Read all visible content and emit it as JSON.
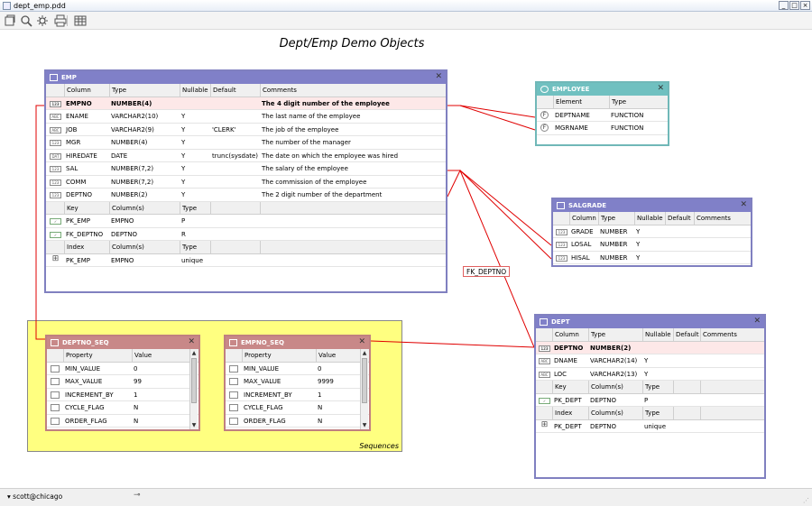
{
  "window": {
    "title": "dept_emp.pdd",
    "buttons": [
      "_",
      "□",
      "×"
    ]
  },
  "toolbar": {
    "icons": [
      "open-icon",
      "zoom-icon",
      "settings-icon",
      "print-icon",
      "grid-icon"
    ]
  },
  "diagram": {
    "title": "Dept/Emp Demo Objects"
  },
  "colors": {
    "table_header": "#8080c8",
    "function_header": "#70c0c0",
    "sequence_header": "#c88888",
    "fk_line": "#e00000",
    "sequence_group": "#ffff80"
  },
  "emp": {
    "title": "EMP",
    "col_headers": [
      "Column",
      "Type",
      "Nullable",
      "Default",
      "Comments"
    ],
    "columns": [
      {
        "icon": "123",
        "name": "EMPNO",
        "type": "NUMBER(4)",
        "nullable": "",
        "default": "",
        "comment": "The 4 digit number of the employee",
        "pk": true
      },
      {
        "icon": "ABC",
        "name": "ENAME",
        "type": "VARCHAR2(10)",
        "nullable": "Y",
        "default": "",
        "comment": "The last name of the employee"
      },
      {
        "icon": "ABC",
        "name": "JOB",
        "type": "VARCHAR2(9)",
        "nullable": "Y",
        "default": "'CLERK'",
        "comment": "The job of the employee"
      },
      {
        "icon": "123",
        "name": "MGR",
        "type": "NUMBER(4)",
        "nullable": "Y",
        "default": "",
        "comment": "The number of the manager"
      },
      {
        "icon": "DAT",
        "name": "HIREDATE",
        "type": "DATE",
        "nullable": "Y",
        "default": "trunc(sysdate)",
        "comment": "The date on which the employee was hired"
      },
      {
        "icon": "123",
        "name": "SAL",
        "type": "NUMBER(7,2)",
        "nullable": "Y",
        "default": "",
        "comment": "The salary of the employee"
      },
      {
        "icon": "123",
        "name": "COMM",
        "type": "NUMBER(7,2)",
        "nullable": "Y",
        "default": "",
        "comment": "The commission of the employee"
      },
      {
        "icon": "123",
        "name": "DEPTNO",
        "type": "NUMBER(2)",
        "nullable": "Y",
        "default": "",
        "comment": "The 2 digit number of the department"
      }
    ],
    "key_headers": [
      "Key",
      "Column(s)",
      "Type"
    ],
    "keys": [
      {
        "name": "PK_EMP",
        "columns": "EMPNO",
        "type": "P"
      },
      {
        "name": "FK_DEPTNO",
        "columns": "DEPTNO",
        "type": "R"
      }
    ],
    "index_headers": [
      "Index",
      "Column(s)",
      "Type"
    ],
    "indexes": [
      {
        "name": "PK_EMP",
        "columns": "EMPNO",
        "type": "unique"
      }
    ]
  },
  "employee": {
    "title": "EMPLOYEE",
    "col_headers": [
      "Element",
      "Type"
    ],
    "elements": [
      {
        "name": "DEPTNAME",
        "type": "FUNCTION"
      },
      {
        "name": "MGRNAME",
        "type": "FUNCTION"
      }
    ]
  },
  "salgrade": {
    "title": "SALGRADE",
    "col_headers": [
      "Column",
      "Type",
      "Nullable",
      "Default",
      "Comments"
    ],
    "columns": [
      {
        "name": "GRADE",
        "type": "NUMBER",
        "nullable": "Y"
      },
      {
        "name": "LOSAL",
        "type": "NUMBER",
        "nullable": "Y"
      },
      {
        "name": "HISAL",
        "type": "NUMBER",
        "nullable": "Y"
      }
    ]
  },
  "dept": {
    "title": "DEPT",
    "col_headers": [
      "Column",
      "Type",
      "Nullable",
      "Default",
      "Comments"
    ],
    "columns": [
      {
        "icon": "123",
        "name": "DEPTNO",
        "type": "NUMBER(2)",
        "nullable": "",
        "pk": true
      },
      {
        "icon": "ABC",
        "name": "DNAME",
        "type": "VARCHAR2(14)",
        "nullable": "Y"
      },
      {
        "icon": "ABC",
        "name": "LOC",
        "type": "VARCHAR2(13)",
        "nullable": "Y"
      }
    ],
    "key_headers": [
      "Key",
      "Column(s)",
      "Type"
    ],
    "keys": [
      {
        "name": "PK_DEPT",
        "columns": "DEPTNO",
        "type": "P"
      }
    ],
    "index_headers": [
      "Index",
      "Column(s)",
      "Type"
    ],
    "indexes": [
      {
        "name": "PK_DEPT",
        "columns": "DEPTNO",
        "type": "unique"
      }
    ]
  },
  "deptno_seq": {
    "title": "DEPTNO_SEQ",
    "headers": [
      "Property",
      "Value"
    ],
    "rows": [
      {
        "name": "MIN_VALUE",
        "value": "0"
      },
      {
        "name": "MAX_VALUE",
        "value": "99"
      },
      {
        "name": "INCREMENT_BY",
        "value": "1"
      },
      {
        "name": "CYCLE_FLAG",
        "value": "N"
      },
      {
        "name": "ORDER_FLAG",
        "value": "N"
      }
    ]
  },
  "empno_seq": {
    "title": "EMPNO_SEQ",
    "headers": [
      "Property",
      "Value"
    ],
    "rows": [
      {
        "name": "MIN_VALUE",
        "value": "0"
      },
      {
        "name": "MAX_VALUE",
        "value": "9999"
      },
      {
        "name": "INCREMENT_BY",
        "value": "1"
      },
      {
        "name": "CYCLE_FLAG",
        "value": "N"
      },
      {
        "name": "ORDER_FLAG",
        "value": "N"
      }
    ]
  },
  "sequences_group": {
    "label": "Sequences"
  },
  "fk_label": "FK_DEPTNO",
  "status": {
    "connection": "scott@chicago"
  }
}
